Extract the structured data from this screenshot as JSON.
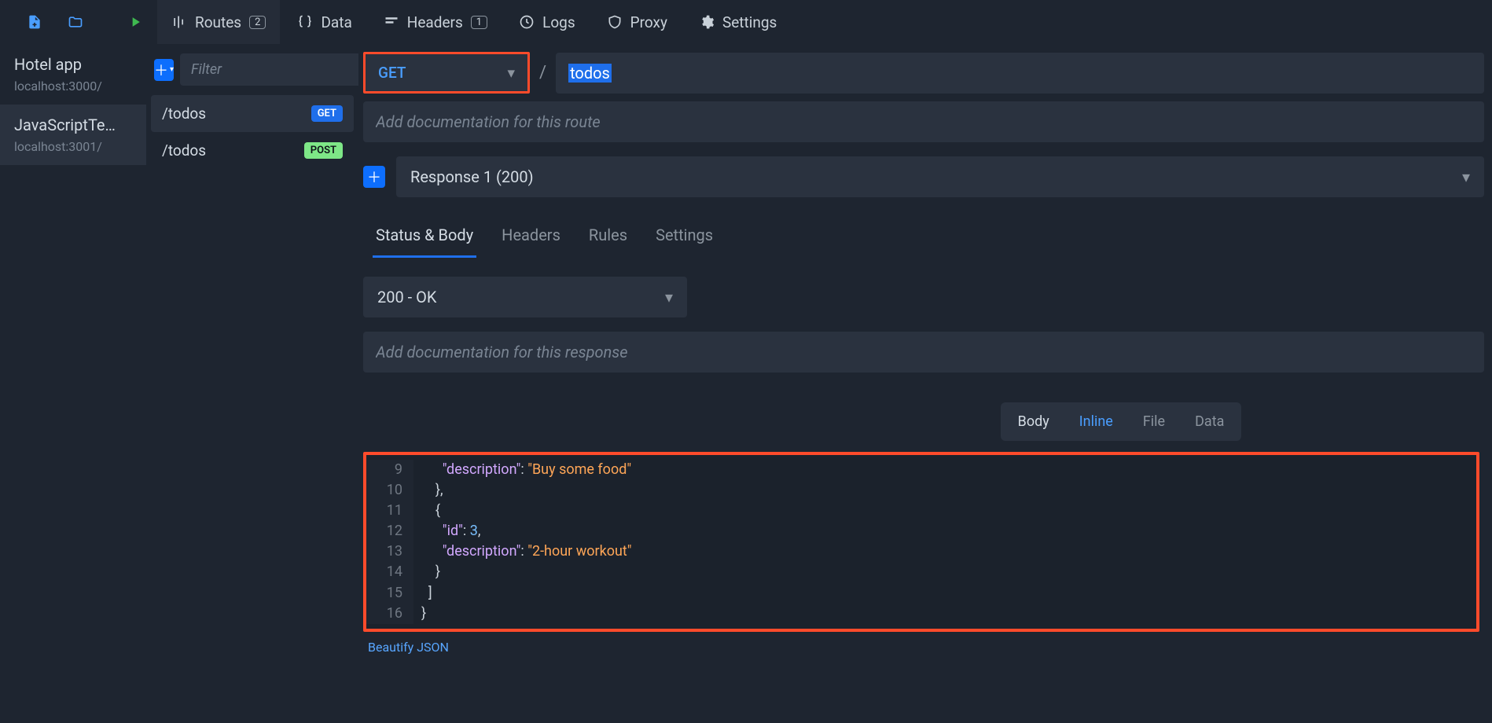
{
  "topbar": {
    "tabs": {
      "routes": {
        "label": "Routes",
        "count": "2"
      },
      "data": {
        "label": "Data"
      },
      "headers": {
        "label": "Headers",
        "count": "1"
      },
      "logs": {
        "label": "Logs"
      },
      "proxy": {
        "label": "Proxy"
      },
      "settings": {
        "label": "Settings"
      }
    }
  },
  "environments": [
    {
      "name": "Hotel app",
      "host": "localhost:3000/"
    },
    {
      "name": "JavaScriptTe…",
      "host": "localhost:3001/"
    }
  ],
  "routes": {
    "filter_placeholder": "Filter",
    "items": [
      {
        "path": "/todos",
        "method": "GET"
      },
      {
        "path": "/todos",
        "method": "POST"
      }
    ]
  },
  "route_editor": {
    "method": "GET",
    "path": "todos",
    "slash": "/",
    "doc_placeholder": "Add documentation for this route",
    "response_label": "Response 1 (200)",
    "tabs": {
      "status_body": "Status & Body",
      "headers": "Headers",
      "rules": "Rules",
      "settings": "Settings"
    },
    "status": "200 - OK",
    "response_doc_placeholder": "Add documentation for this response",
    "body_toggle": {
      "label": "Body",
      "inline": "Inline",
      "file": "File",
      "data": "Data"
    },
    "beautify": "Beautify JSON",
    "code": [
      {
        "n": "9",
        "indent": "      ",
        "k": "\"description\"",
        "sep": ": ",
        "v": "\"Buy some food\"",
        "tail": ""
      },
      {
        "n": "10",
        "text": "    },"
      },
      {
        "n": "11",
        "text": "    {"
      },
      {
        "n": "12",
        "indent": "      ",
        "k": "\"id\"",
        "sep": ": ",
        "num": "3",
        "tail": ","
      },
      {
        "n": "13",
        "indent": "      ",
        "k": "\"description\"",
        "sep": ": ",
        "v": "\"2-hour workout\"",
        "tail": ""
      },
      {
        "n": "14",
        "text": "    }"
      },
      {
        "n": "15",
        "text": "  ]"
      },
      {
        "n": "16",
        "text": "}"
      }
    ]
  }
}
